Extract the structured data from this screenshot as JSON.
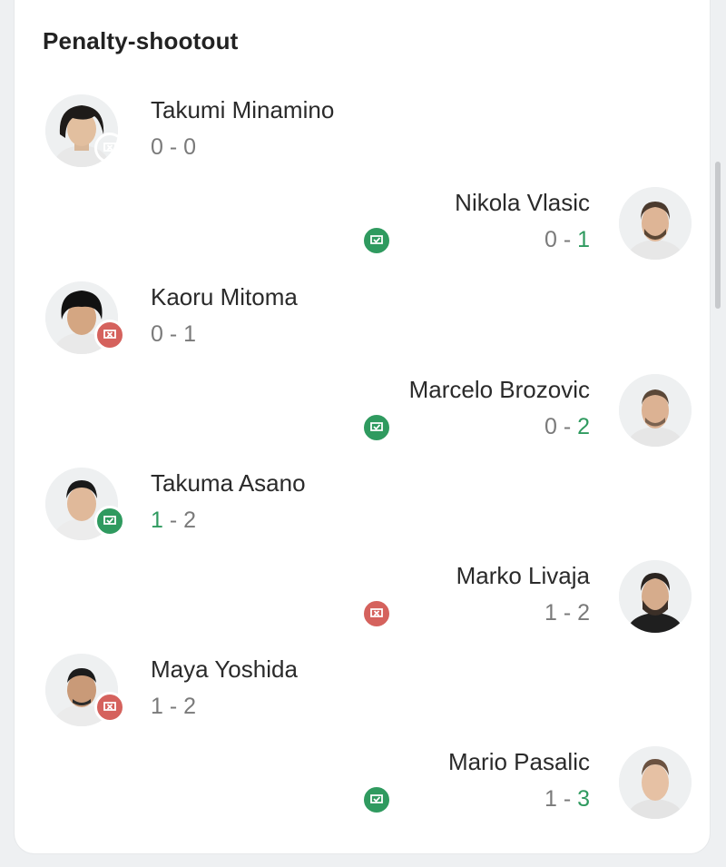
{
  "card": {
    "title": "Penalty-shootout"
  },
  "colors": {
    "goal": "#2f9a5f",
    "miss": "#d5625d",
    "name": "#2a2a2a",
    "score": "#7a7a7a"
  },
  "kicks": [
    {
      "side": "left",
      "player": "Takumi Minamino",
      "home": "0",
      "sep": " - ",
      "away": "0",
      "result": "miss",
      "scored_team": "none",
      "icon": "missed-penalty-icon"
    },
    {
      "side": "right",
      "player": "Nikola Vlasic",
      "home": "0",
      "sep": " - ",
      "away": "1",
      "result": "goal",
      "scored_team": "away",
      "icon": "scored-penalty-icon"
    },
    {
      "side": "left",
      "player": "Kaoru Mitoma",
      "home": "0",
      "sep": " - ",
      "away": "1",
      "result": "miss",
      "scored_team": "none",
      "icon": "missed-penalty-icon"
    },
    {
      "side": "right",
      "player": "Marcelo Brozovic",
      "home": "0",
      "sep": " - ",
      "away": "2",
      "result": "goal",
      "scored_team": "away",
      "icon": "scored-penalty-icon"
    },
    {
      "side": "left",
      "player": "Takuma Asano",
      "home": "1",
      "sep": " - ",
      "away": "2",
      "result": "goal",
      "scored_team": "home",
      "icon": "scored-penalty-icon"
    },
    {
      "side": "right",
      "player": "Marko Livaja",
      "home": "1",
      "sep": " - ",
      "away": "2",
      "result": "miss",
      "scored_team": "none",
      "icon": "missed-penalty-icon"
    },
    {
      "side": "left",
      "player": "Maya Yoshida",
      "home": "1",
      "sep": " - ",
      "away": "2",
      "result": "miss",
      "scored_team": "none",
      "icon": "missed-penalty-icon"
    },
    {
      "side": "right",
      "player": "Mario Pasalic",
      "home": "1",
      "sep": " - ",
      "away": "3",
      "result": "goal",
      "scored_team": "away",
      "icon": "scored-penalty-icon"
    }
  ]
}
